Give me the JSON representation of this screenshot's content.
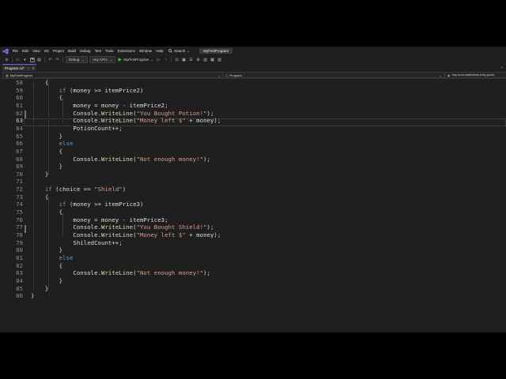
{
  "menu": {
    "items": [
      "File",
      "Edit",
      "View",
      "Git",
      "Project",
      "Build",
      "Debug",
      "Test",
      "Tools",
      "Extensions",
      "Window",
      "Help"
    ],
    "search_label": "Search",
    "solution_name": "MyFirstProgram"
  },
  "toolbar": {
    "configuration": "Debug",
    "platform": "Any CPU",
    "run_target": "MyFirstProgram"
  },
  "tabs": [
    {
      "label": "Program.cs*",
      "active": true
    }
  ],
  "navbar": {
    "project": "MyFirstProgram",
    "type": "Program",
    "member": "<top-level-statements-entry-point>"
  },
  "editor": {
    "current_line": 63,
    "lines": [
      {
        "n": 58,
        "text": "    {"
      },
      {
        "n": 59,
        "text": "        if (money >= itemPrice2)"
      },
      {
        "n": 60,
        "text": "        {"
      },
      {
        "n": 61,
        "text": "            money = money - itemPrice2;"
      },
      {
        "n": 62,
        "text": "            Console.WriteLine(\"You Bought Potion!\");"
      },
      {
        "n": 63,
        "text": "            Console.WriteLine(\"Money left $\" + money);"
      },
      {
        "n": 64,
        "text": "            PotionCount++;"
      },
      {
        "n": 65,
        "text": "        }"
      },
      {
        "n": 66,
        "text": "        else"
      },
      {
        "n": 67,
        "text": "        {"
      },
      {
        "n": 68,
        "text": "            Console.WriteLine(\"Not enough money!\");"
      },
      {
        "n": 69,
        "text": "        }"
      },
      {
        "n": 70,
        "text": "    }"
      },
      {
        "n": 71,
        "text": ""
      },
      {
        "n": 72,
        "text": "    if (choice == \"Shield\")"
      },
      {
        "n": 73,
        "text": "    {"
      },
      {
        "n": 74,
        "text": "        if (money >= itemPrice3)"
      },
      {
        "n": 75,
        "text": "        {"
      },
      {
        "n": 76,
        "text": "            money = money - itemPrice3;"
      },
      {
        "n": 77,
        "text": "            Console.WriteLine(\"You Bought Shield!\");"
      },
      {
        "n": 78,
        "text": "            Console.WriteLine(\"Money left $\" + money);"
      },
      {
        "n": 79,
        "text": "            ShiledCount++;"
      },
      {
        "n": 80,
        "text": "        }"
      },
      {
        "n": 81,
        "text": "        else"
      },
      {
        "n": 82,
        "text": "        {"
      },
      {
        "n": 83,
        "text": "            Console.WriteLine(\"Not enough money!\");"
      },
      {
        "n": 84,
        "text": "        }"
      },
      {
        "n": 85,
        "text": "    }"
      },
      {
        "n": 86,
        "text": "}"
      }
    ]
  },
  "colors": {
    "keyword": "#569cd6",
    "string": "#d69d85",
    "method": "#dcdcaa",
    "identifier": "#dcdcdc",
    "line_number": "#8c8c8c",
    "background": "#1f1f1f",
    "accent": "#7160e8"
  },
  "icons": [
    "visual-studio-logo-icon",
    "search-icon",
    "save-icon",
    "undo-icon",
    "redo-icon",
    "run-icon",
    "close-icon"
  ]
}
